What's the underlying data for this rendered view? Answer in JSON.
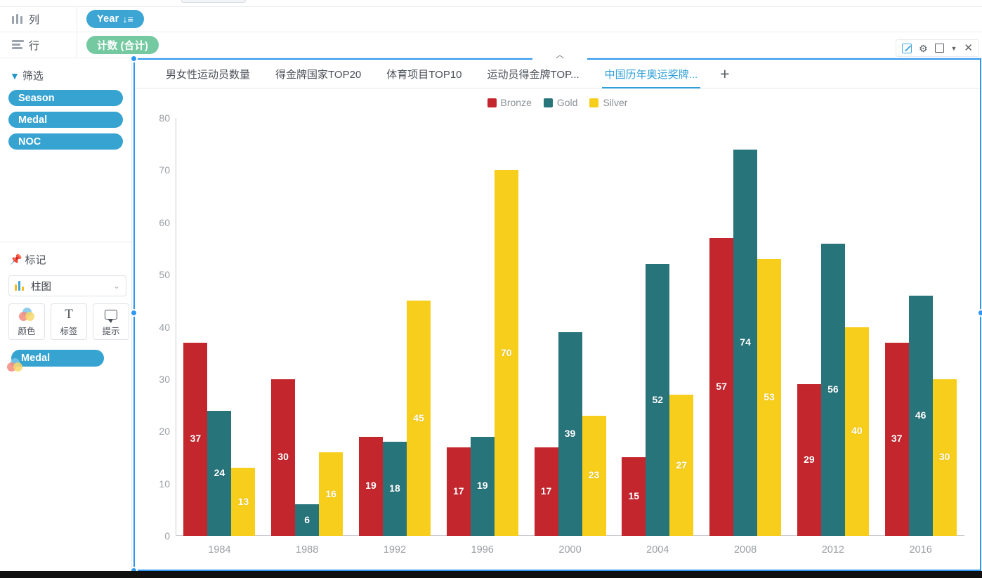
{
  "shelves": {
    "columns": {
      "label": "列",
      "icon": "columns-bars-icon",
      "pill": "Year",
      "sort_mark": "↓≡"
    },
    "rows": {
      "label": "行",
      "icon": "rows-lines-icon",
      "pill": "计数 (合计)"
    }
  },
  "sidebar": {
    "filters": {
      "title": "筛选",
      "icon": "filter-icon",
      "items": [
        "Season",
        "Medal",
        "NOC"
      ]
    },
    "marks": {
      "title": "标记",
      "icon": "pin-icon",
      "mark_type": "柱图",
      "buttons": [
        {
          "label": "颜色",
          "icon": "color-venn-icon"
        },
        {
          "label": "标签",
          "icon": "label-text-icon"
        },
        {
          "label": "提示",
          "icon": "tooltip-bubble-icon"
        }
      ],
      "encodings": [
        {
          "icon": "color-venn-icon",
          "field": "Medal"
        }
      ]
    }
  },
  "toolbar": {
    "icons": [
      "edit-icon",
      "gear-icon",
      "square-icon",
      "caret-down-icon",
      "close-icon"
    ]
  },
  "tabs": {
    "items": [
      {
        "label": "男女性运动员数量",
        "active": false
      },
      {
        "label": "得金牌国家TOP20",
        "active": false
      },
      {
        "label": "体育项目TOP10",
        "active": false
      },
      {
        "label": "运动员得金牌TOP...",
        "active": false
      },
      {
        "label": "中国历年奥运奖牌...",
        "active": true
      }
    ],
    "add_label": "+"
  },
  "colors": {
    "bronze": "#C4262E",
    "gold": "#27747B",
    "silver": "#F8CE1C",
    "accent": "#2F97F0",
    "pill_blue": "#36A3D1",
    "pill_green": "#74C9A0",
    "axis": "#9A9EA3"
  },
  "chart_data": {
    "type": "bar",
    "title": "",
    "xlabel": "",
    "ylabel": "",
    "ylim": [
      0,
      80
    ],
    "yticks": [
      0,
      10,
      20,
      30,
      40,
      50,
      60,
      70,
      80
    ],
    "grid": false,
    "legend_position": "top-center",
    "categories": [
      "1984",
      "1988",
      "1992",
      "1996",
      "2000",
      "2004",
      "2008",
      "2012",
      "2016"
    ],
    "series": [
      {
        "name": "Bronze",
        "color": "#C4262E",
        "values": [
          37,
          30,
          19,
          17,
          17,
          15,
          57,
          29,
          37
        ]
      },
      {
        "name": "Gold",
        "color": "#27747B",
        "values": [
          24,
          6,
          18,
          19,
          39,
          52,
          74,
          56,
          46
        ]
      },
      {
        "name": "Silver",
        "color": "#F8CE1C",
        "values": [
          13,
          16,
          45,
          70,
          23,
          27,
          53,
          40,
          30
        ]
      }
    ]
  }
}
